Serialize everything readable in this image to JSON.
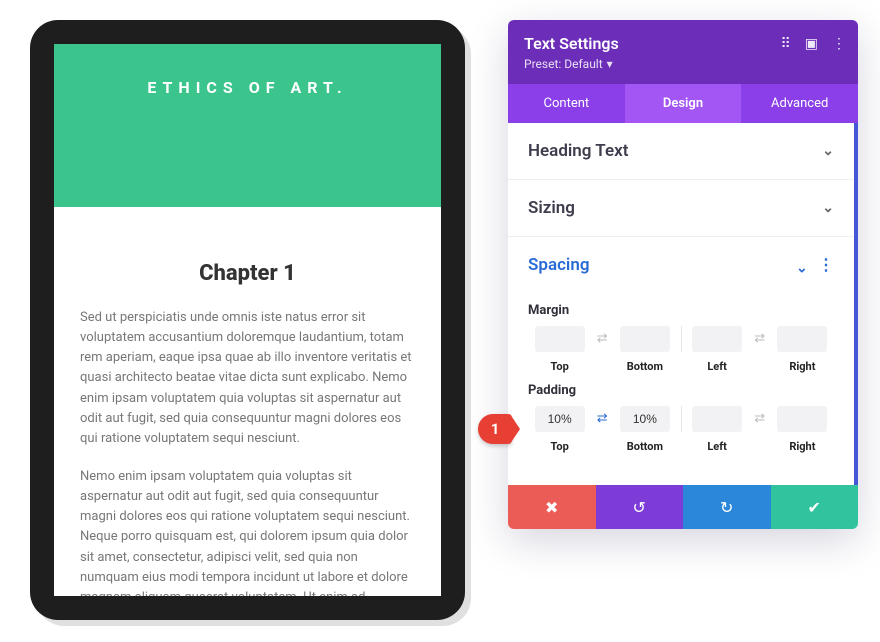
{
  "preview": {
    "hero_text": "ETHICS OF ART.",
    "chapter_title": "Chapter 1",
    "para1": "Sed ut perspiciatis unde omnis iste natus error sit voluptatem accusantium doloremque laudantium, totam rem aperiam, eaque ipsa quae ab illo inventore veritatis et quasi architecto beatae vitae dicta sunt explicabo. Nemo enim ipsam voluptatem quia voluptas sit aspernatur aut odit aut fugit, sed quia consequuntur magni dolores eos qui ratione voluptatem sequi nesciunt.",
    "para2": "Nemo enim ipsam voluptatem quia voluptas sit aspernatur aut odit aut fugit, sed quia consequuntur magni dolores eos qui ratione voluptatem sequi nesciunt. Neque porro quisquam est, qui dolorem ipsum quia dolor sit amet, consectetur, adipisci velit, sed quia non numquam eius modi tempora incidunt ut labore et dolore magnam aliquam quaerat voluptatem. Ut enim ad"
  },
  "panel": {
    "title": "Text Settings",
    "preset_label": "Preset: Default",
    "tabs": {
      "content": "Content",
      "design": "Design",
      "advanced": "Advanced"
    },
    "sections": {
      "heading": "Heading Text",
      "sizing": "Sizing",
      "spacing": "Spacing"
    },
    "margin": {
      "label": "Margin",
      "top": "",
      "bottom": "",
      "left": "",
      "right": "",
      "sub": {
        "top": "Top",
        "bottom": "Bottom",
        "left": "Left",
        "right": "Right"
      }
    },
    "padding": {
      "label": "Padding",
      "top": "10%",
      "bottom": "10%",
      "left": "",
      "right": "",
      "sub": {
        "top": "Top",
        "bottom": "Bottom",
        "left": "Left",
        "right": "Right"
      }
    }
  },
  "badge": {
    "number": "1"
  }
}
